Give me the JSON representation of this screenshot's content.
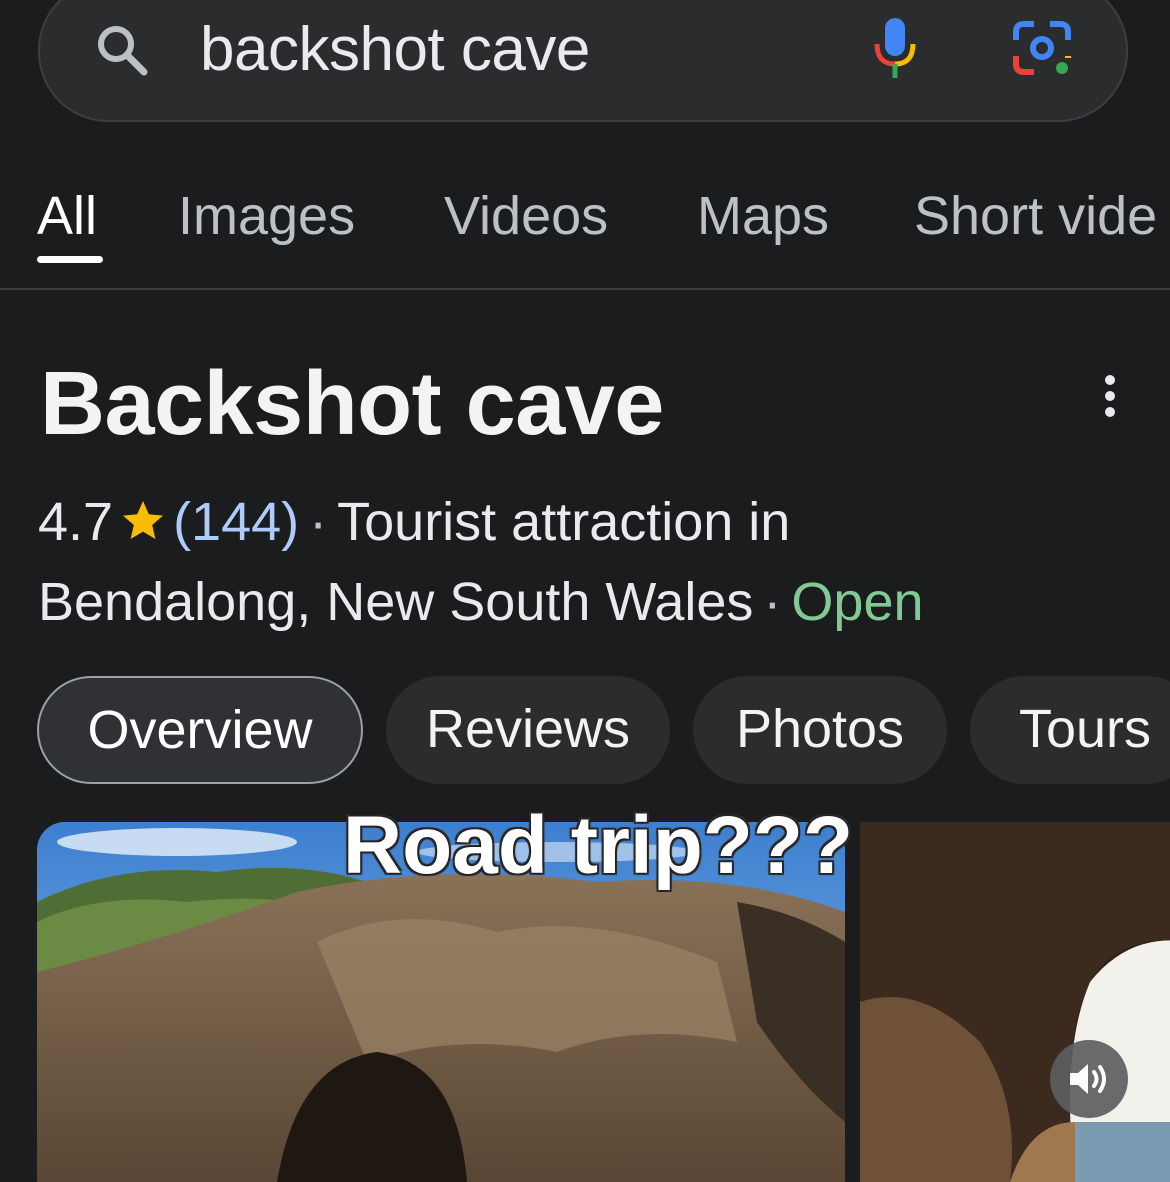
{
  "search": {
    "query": "backshot cave"
  },
  "tabs": [
    {
      "label": "All",
      "active": true
    },
    {
      "label": "Images",
      "active": false
    },
    {
      "label": "Videos",
      "active": false
    },
    {
      "label": "Maps",
      "active": false
    },
    {
      "label": "Short vide",
      "active": false
    }
  ],
  "place": {
    "title": "Backshot cave",
    "rating": "4.7",
    "review_count": "(144)",
    "separator": "·",
    "category": "Tourist attraction in",
    "location": "Bendalong, New South Wales",
    "status": "Open"
  },
  "chips": [
    {
      "label": "Overview",
      "active": true
    },
    {
      "label": "Reviews",
      "active": false
    },
    {
      "label": "Photos",
      "active": false
    },
    {
      "label": "Tours",
      "active": false
    }
  ],
  "overlay": {
    "text": "Road trip???"
  },
  "icons": {
    "search": "search-icon",
    "mic": "mic-icon",
    "lens": "lens-icon",
    "more": "more-vert-icon",
    "star": "star-icon",
    "sound": "volume-icon"
  },
  "colors": {
    "background": "#1b1c1d",
    "rating_count": "#aecbfa",
    "open": "#81c995",
    "star": "#fbbc04"
  }
}
